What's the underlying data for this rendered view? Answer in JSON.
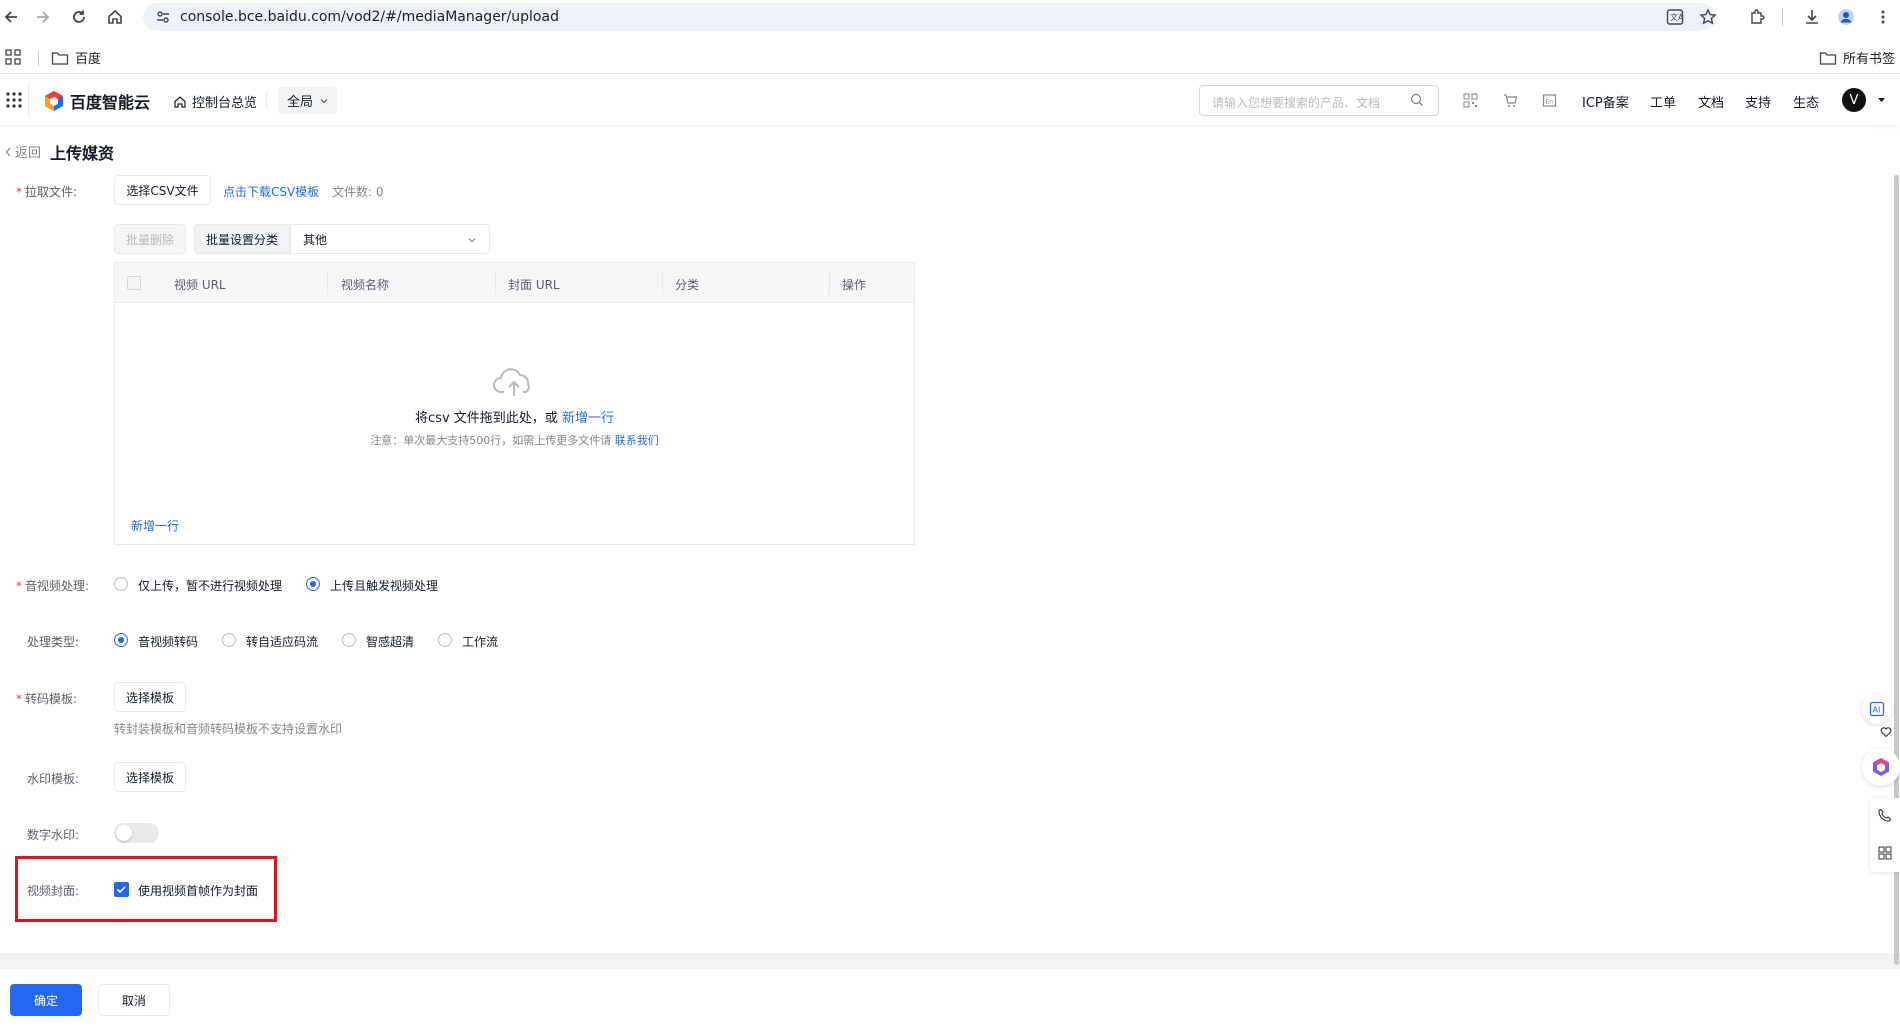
{
  "browser": {
    "url": "console.bce.baidu.com/vod2/#/mediaManager/upload",
    "bookmark_folder": "百度",
    "all_bookmarks": "所有书签"
  },
  "header": {
    "logo_text": "百度智能云",
    "console_overview": "控制台总览",
    "region": "全局",
    "search_placeholder": "请输入您想要搜索的产品、文档",
    "nav": [
      "ICP备案",
      "工单",
      "文档",
      "支持",
      "生态"
    ],
    "avatar_letter": "V"
  },
  "page": {
    "back": "返回",
    "title": "上传媒资"
  },
  "pull_file": {
    "label": "拉取文件:",
    "select_csv": "选择CSV文件",
    "download_template": "点击下载CSV模板",
    "file_count": "文件数: 0",
    "batch_delete": "批量删除",
    "batch_category_label": "批量设置分类",
    "category_value": "其他"
  },
  "table": {
    "columns": [
      "视频 URL",
      "视频名称",
      "封面 URL",
      "分类",
      "操作"
    ],
    "drop_text": "将csv 文件拖到此处，或",
    "drop_add_row": "新增一行",
    "note": "注意：单次最大支持500行，如需上传更多文件请",
    "contact": "联系我们",
    "add_row": "新增一行"
  },
  "av_processing": {
    "label": "音视频处理:",
    "options": [
      "仅上传，暂不进行视频处理",
      "上传且触发视频处理"
    ],
    "selected": "上传且触发视频处理"
  },
  "process_type": {
    "label": "处理类型:",
    "options": [
      "音视频转码",
      "转自适应码流",
      "智感超清",
      "工作流"
    ],
    "selected": "音视频转码"
  },
  "transcode_template": {
    "label": "转码模板:",
    "button": "选择模板",
    "hint": "转封装模板和音频转码模板不支持设置水印"
  },
  "watermark_template": {
    "label": "水印模板:",
    "button": "选择模板"
  },
  "digital_watermark": {
    "label": "数字水印:",
    "enabled": false
  },
  "video_cover": {
    "label": "视频封面:",
    "checkbox_label": "使用视频首帧作为封面",
    "checked": true
  },
  "footer": {
    "confirm": "确定",
    "cancel": "取消"
  },
  "colors": {
    "accent": "#2468f2",
    "highlight_box": "#e8101b",
    "required": "#f33e3e"
  }
}
